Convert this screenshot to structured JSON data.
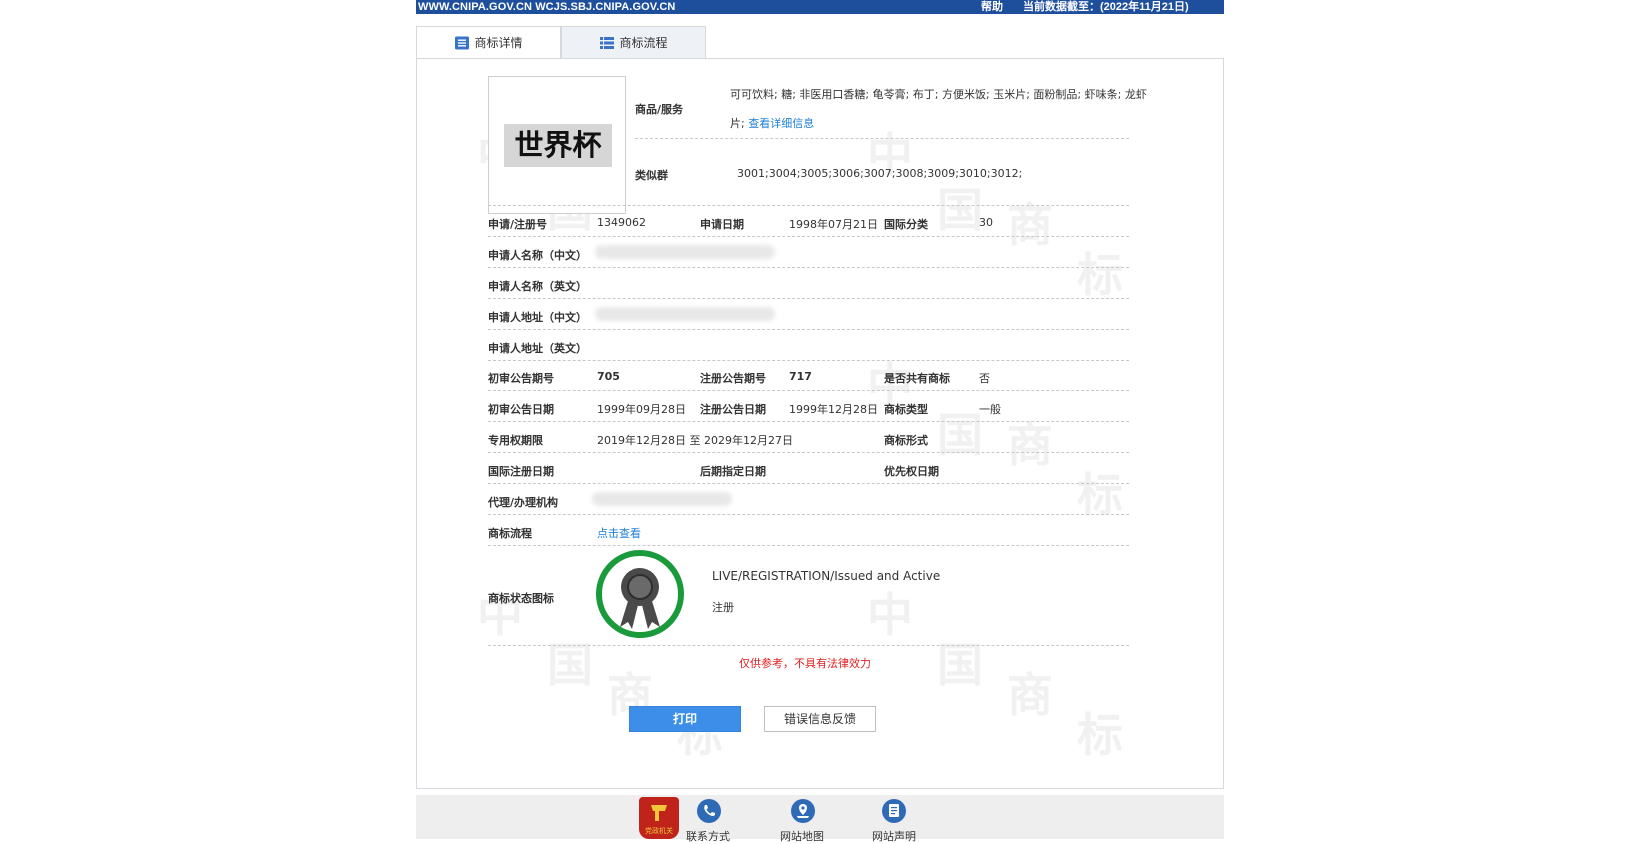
{
  "topbar": {
    "site": "WWW.CNIPA.GOV.CN WCJS.SBJ.CNIPA.GOV.CN",
    "help": "帮助",
    "as_of": "当前数据截至：(2022年11月21日)"
  },
  "tabs": [
    {
      "label": "商标详情",
      "icon": "document-icon",
      "active": true
    },
    {
      "label": "商标流程",
      "icon": "list-icon",
      "active": false
    }
  ],
  "watermark": {
    "chars": [
      "中",
      "国",
      "商",
      "标"
    ]
  },
  "trademark": {
    "image_text": "世界杯",
    "goods_label": "商品/服务",
    "goods_line1": "可可饮料; 糖; 非医用口香糖; 龟苓膏; 布丁; 方便米饭; 玉米片; 面粉制品; 虾味条; 龙虾",
    "goods_line2_prefix": "片;",
    "goods_more_link": "查看详细信息",
    "similar_label": "类似群",
    "similar_value": "3001;3004;3005;3006;3007;3008;3009;3010;3012;"
  },
  "fields": {
    "reg_no_label": "申请/注册号",
    "reg_no": "1349062",
    "app_date_label": "申请日期",
    "app_date": "1998年07月21日",
    "intl_class_label": "国际分类",
    "intl_class": "30",
    "applicant_cn_label": "申请人名称（中文）",
    "applicant_en_label": "申请人名称（英文）",
    "address_cn_label": "申请人地址（中文）",
    "address_en_label": "申请人地址（英文）",
    "prelim_no_label": "初审公告期号",
    "prelim_no": "705",
    "reg_pub_no_label": "注册公告期号",
    "reg_pub_no": "717",
    "shared_label": "是否共有商标",
    "shared": "否",
    "prelim_date_label": "初审公告日期",
    "prelim_date": "1999年09月28日",
    "reg_pub_date_label": "注册公告日期",
    "reg_pub_date": "1999年12月28日",
    "tm_type_label": "商标类型",
    "tm_type": "一般",
    "exclusive_label": "专用权期限",
    "exclusive": "2019年12月28日 至 2029年12月27日",
    "tm_form_label": "商标形式",
    "intl_reg_date_label": "国际注册日期",
    "later_date_label": "后期指定日期",
    "priority_date_label": "优先权日期",
    "agent_label": "代理/办理机构",
    "process_label": "商标流程",
    "process_link": "点击查看",
    "status_label": "商标状态图标",
    "status_en": "LIVE/REGISTRATION/Issued and Active",
    "status_cn": "注册"
  },
  "disclaimer": "仅供参考，不具有法律效力",
  "buttons": {
    "print": "打印",
    "feedback": "错误信息反馈"
  },
  "footer": {
    "logo_text": "党政机关",
    "links": [
      {
        "label": "联系方式",
        "icon": "phone-icon"
      },
      {
        "label": "网站地图",
        "icon": "map-icon"
      },
      {
        "label": "网站声明",
        "icon": "statement-icon"
      }
    ]
  },
  "colors": {
    "topbar_bg": "#1e4f9c",
    "link": "#1e7fd6",
    "prev_arrow": "#f08a1c",
    "next_arrow": "#3c8fd8",
    "status_ring": "#1a9a3b",
    "disclaimer": "#e02020",
    "print_button": "#3d8ee8"
  }
}
